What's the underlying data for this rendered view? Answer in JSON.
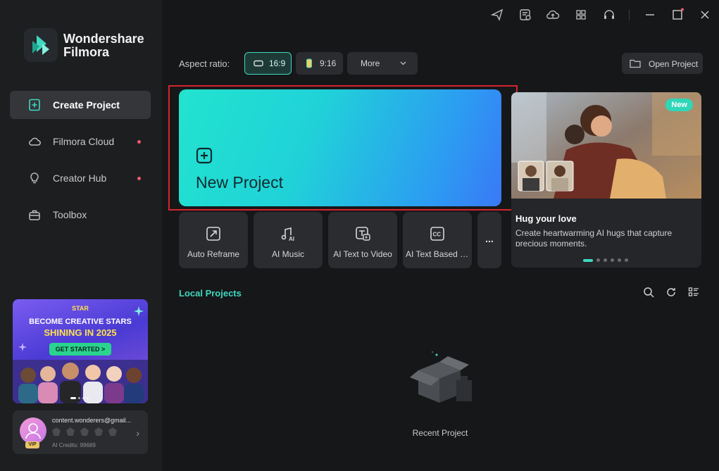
{
  "app": {
    "brand_line1": "Wondershare",
    "brand_line2": "Filmora"
  },
  "sidebar": {
    "items": [
      {
        "label": "Create Project",
        "active": true
      },
      {
        "label": "Filmora Cloud",
        "has_dot": true
      },
      {
        "label": "Creator Hub",
        "has_dot": true
      },
      {
        "label": "Toolbox"
      }
    ],
    "promo": {
      "small": "STAR",
      "line1": "BECOME CREATIVE STARS",
      "line2": "SHINING IN 2025",
      "button": "GET STARTED >"
    },
    "account": {
      "email": "content.wonderers@gmail...",
      "badge": "VIP",
      "credits": "AI Credits: 99689"
    }
  },
  "titlebar": {
    "icons": [
      "send-icon",
      "task-list-icon",
      "cloud-upload-icon",
      "apps-grid-icon",
      "headset-icon",
      "minimize-icon",
      "maximize-icon",
      "close-icon"
    ]
  },
  "aspect": {
    "label": "Aspect ratio:",
    "options": [
      {
        "label": "16:9",
        "selected": true
      },
      {
        "label": "9:16"
      }
    ],
    "more_label": "More"
  },
  "open_project": {
    "label": "Open Project"
  },
  "new_project": {
    "label": "New Project"
  },
  "tools": [
    {
      "label": "Auto Reframe",
      "icon": "auto-reframe-icon"
    },
    {
      "label": "AI Music",
      "icon": "ai-music-icon"
    },
    {
      "label": "AI Text to Video",
      "icon": "ai-text-to-video-icon"
    },
    {
      "label": "AI Text Based E...",
      "icon": "closed-caption-icon"
    },
    {
      "label": "...",
      "icon": "more-icon"
    }
  ],
  "feature": {
    "badge": "New",
    "title": "Hug your love",
    "description": "Create heartwarming AI hugs that capture precious moments.",
    "page_index": 1,
    "page_count": 6
  },
  "local_projects": {
    "title": "Local Projects",
    "empty_label": "Recent Project"
  },
  "colors": {
    "accent": "#3fd8c0",
    "highlight_frame": "#d4262c",
    "background": "#161719",
    "sidebar": "#1d1e20"
  }
}
